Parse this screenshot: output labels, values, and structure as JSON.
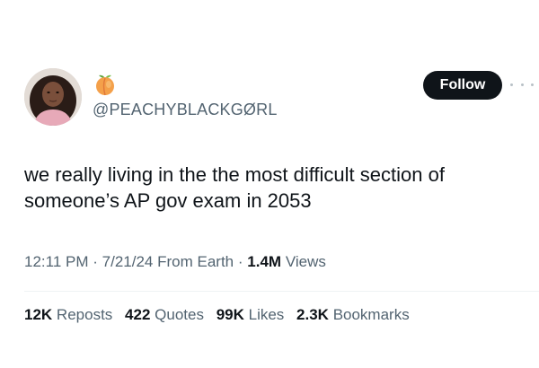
{
  "tweet": {
    "author": {
      "emoji_name": "peach-emoji",
      "handle": "@PEACHYBLACKGØRL"
    },
    "follow_label": "Follow",
    "more_icon": "more-horizontal-icon",
    "text_line1": "we really living in the the most difficult section of",
    "text_line2": "someone’s AP gov exam in 2053",
    "time": "12:11 PM",
    "date": "7/21/24",
    "source": "From Earth",
    "separator": "·",
    "views_count": "1.4M",
    "views_label": "Views",
    "stats": [
      {
        "count": "12K",
        "label": "Reposts"
      },
      {
        "count": "422",
        "label": "Quotes"
      },
      {
        "count": "99K",
        "label": "Likes"
      },
      {
        "count": "2.3K",
        "label": "Bookmarks"
      }
    ]
  },
  "colors": {
    "text": "#0f1419",
    "muted": "#536471",
    "follow_bg": "#0f1419",
    "follow_text": "#ffffff",
    "peach": "#f4a04a"
  }
}
